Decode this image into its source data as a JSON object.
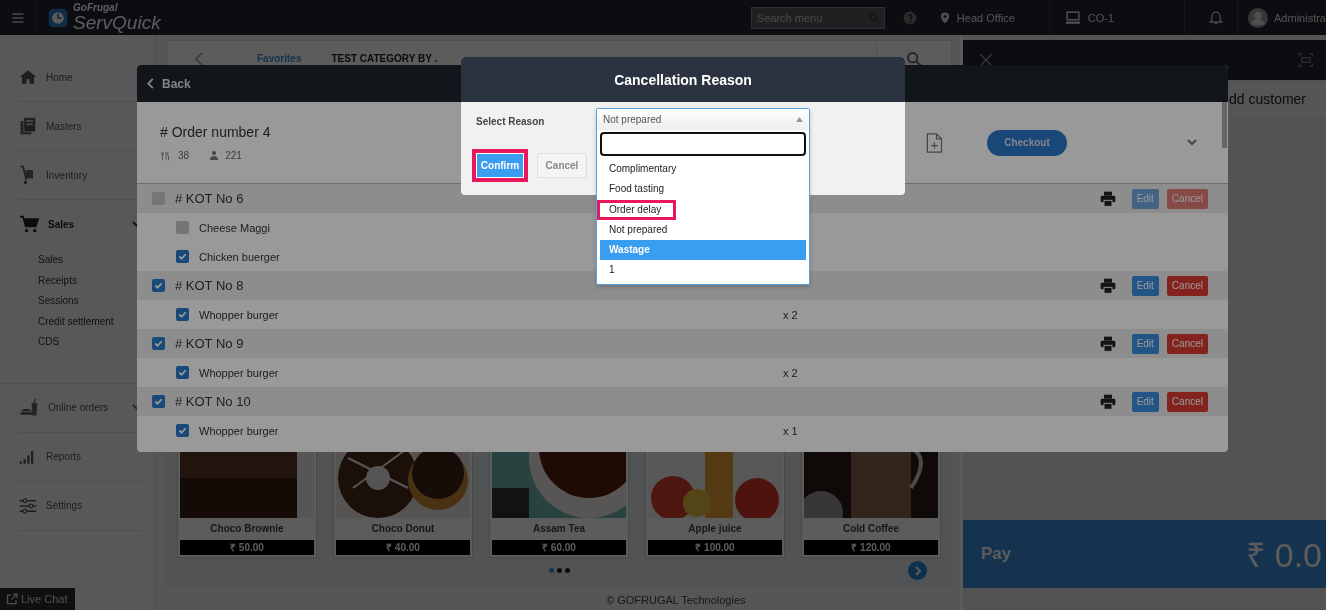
{
  "topbar": {
    "brand_small": "GoFrugal",
    "brand": "ServQuick",
    "search": {
      "placeholder": "Search menu"
    },
    "location": "Head Office",
    "counter": "CO-1",
    "user": "Administra"
  },
  "sidebar": {
    "items": [
      {
        "label": "Home",
        "kind": "link",
        "selected": false
      },
      {
        "label": "Masters",
        "kind": "link",
        "selected": false
      },
      {
        "label": "Inventory",
        "kind": "link",
        "selected": false
      },
      {
        "label": "Sales",
        "kind": "group",
        "selected": true,
        "expanded": true,
        "children": [
          {
            "label": "Sales"
          },
          {
            "label": "Receipts"
          },
          {
            "label": "Sessions"
          },
          {
            "label": "Credit settlement"
          },
          {
            "label": "CDS"
          }
        ]
      },
      {
        "label": "Online orders",
        "kind": "group",
        "selected": false,
        "expanded": false
      },
      {
        "label": "Reports",
        "kind": "link",
        "selected": false
      },
      {
        "label": "Settings",
        "kind": "link",
        "selected": false
      }
    ],
    "live_chat": "Live Chat"
  },
  "category_bar": {
    "tabs": [
      {
        "label": "Favorites",
        "selected": true
      },
      {
        "label": "TEST CATEGORY BY .",
        "selected": false
      }
    ]
  },
  "products": [
    {
      "name": "Choco Brownie",
      "price": "₹ 50.00"
    },
    {
      "name": "Choco Donut",
      "price": "₹ 40.00"
    },
    {
      "name": "Assam Tea",
      "price": "₹ 60.00"
    },
    {
      "name": "Apple juice",
      "price": "₹ 100.00"
    },
    {
      "name": "Cold Coffee",
      "price": "₹ 120.00"
    }
  ],
  "pager": [
    {
      "selected": true
    },
    {
      "selected": false
    },
    {
      "selected": false
    }
  ],
  "footer": "© GOFRUGAL Technologies",
  "cart": {
    "add_customer": "dd customer",
    "pay": "Pay",
    "total": "₹ 0.0"
  },
  "order": {
    "back": "Back",
    "title": "# Order number 4",
    "covers": "38",
    "guests": "221",
    "checkout": "Checkout",
    "kots": [
      {
        "title": "# KOT No 6",
        "checked": false,
        "disabled": true,
        "edit": "Edit",
        "cancel": "Cancel",
        "items": [
          {
            "name": "Cheese Maggi",
            "checked": false
          },
          {
            "name": "Chicken buerger",
            "checked": true
          }
        ]
      },
      {
        "title": "# KOT No 8",
        "checked": true,
        "disabled": false,
        "edit": "Edit",
        "cancel": "Cancel",
        "items": [
          {
            "name": "Whopper burger",
            "checked": true,
            "qty": "x 2"
          }
        ]
      },
      {
        "title": "# KOT No 9",
        "checked": true,
        "disabled": false,
        "edit": "Edit",
        "cancel": "Cancel",
        "items": [
          {
            "name": "Whopper burger",
            "checked": true,
            "qty": "x 2"
          }
        ]
      },
      {
        "title": "# KOT No 10",
        "checked": true,
        "disabled": false,
        "edit": "Edit",
        "cancel": "Cancel",
        "items": [
          {
            "name": "Whopper burger",
            "checked": true,
            "qty": "x 1"
          }
        ]
      }
    ]
  },
  "dialog": {
    "title": "Cancellation Reason",
    "label": "Select Reason",
    "select": {
      "value": "Not prepared",
      "expanded": true
    },
    "options": [
      {
        "label": "Complimentary",
        "highlighted": false,
        "annotated": false
      },
      {
        "label": "Food tasting",
        "highlighted": false,
        "annotated": false
      },
      {
        "label": "Order delay",
        "highlighted": false,
        "annotated": true
      },
      {
        "label": "Not prepared",
        "highlighted": false,
        "annotated": false
      },
      {
        "label": "Wastage",
        "highlighted": true,
        "annotated": false
      },
      {
        "label": "1",
        "highlighted": false,
        "annotated": false
      }
    ],
    "confirm": {
      "label": "Confirm",
      "annotated": true
    },
    "cancel": "Cancel"
  }
}
